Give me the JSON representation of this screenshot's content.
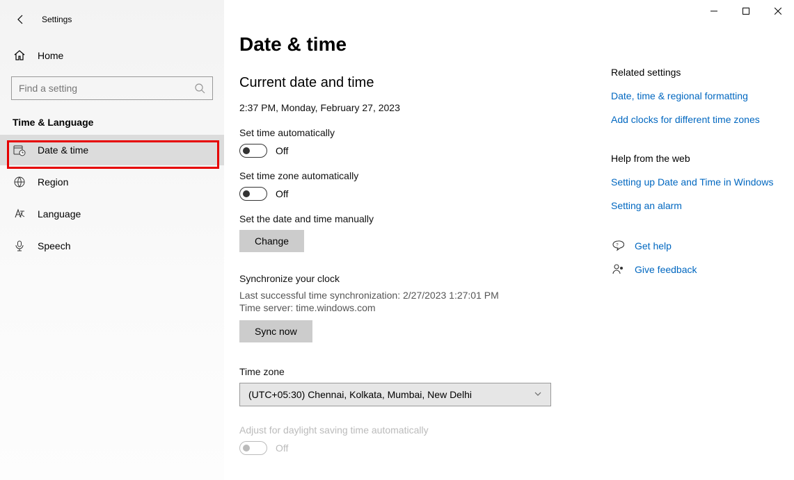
{
  "window": {
    "title": "Settings"
  },
  "sidebar": {
    "home": "Home",
    "search_placeholder": "Find a setting",
    "category": "Time & Language",
    "items": [
      {
        "name": "date-time",
        "label": "Date & time",
        "selected": true
      },
      {
        "name": "region",
        "label": "Region",
        "selected": false
      },
      {
        "name": "language",
        "label": "Language",
        "selected": false
      },
      {
        "name": "speech",
        "label": "Speech",
        "selected": false
      }
    ]
  },
  "page": {
    "heading": "Date & time",
    "current_heading": "Current date and time",
    "current_value": "2:37 PM, Monday, February 27, 2023",
    "set_time_auto_label": "Set time automatically",
    "set_time_auto_state": "Off",
    "set_tz_auto_label": "Set time zone automatically",
    "set_tz_auto_state": "Off",
    "manual_label": "Set the date and time manually",
    "change_button": "Change",
    "sync_heading": "Synchronize your clock",
    "sync_last": "Last successful time synchronization: 2/27/2023 1:27:01 PM",
    "sync_server": "Time server: time.windows.com",
    "sync_button": "Sync now",
    "tz_label": "Time zone",
    "tz_value": "(UTC+05:30) Chennai, Kolkata, Mumbai, New Delhi",
    "dst_label": "Adjust for daylight saving time automatically",
    "dst_state": "Off"
  },
  "right": {
    "related_title": "Related settings",
    "related_links": [
      "Date, time & regional formatting",
      "Add clocks for different time zones"
    ],
    "help_title": "Help from the web",
    "help_links": [
      "Setting up Date and Time in Windows",
      "Setting an alarm"
    ],
    "get_help": "Get help",
    "feedback": "Give feedback"
  }
}
